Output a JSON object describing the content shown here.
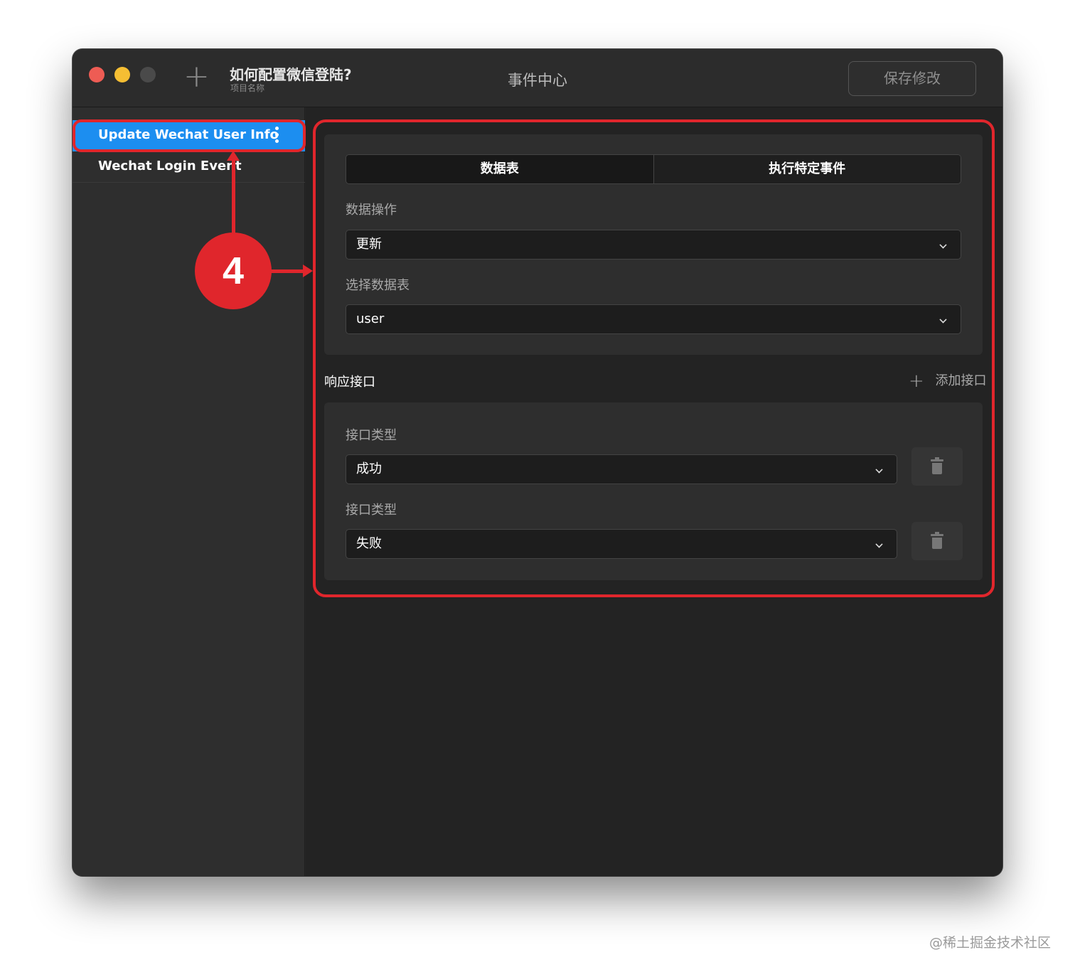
{
  "titlebar": {
    "project_title": "如何配置微信登陆?",
    "project_subtitle": "项目名称",
    "center_title": "事件中心",
    "save_label": "保存修改",
    "add_icon": "+"
  },
  "sidebar": {
    "items": [
      {
        "label": "Update Wechat User Info",
        "active": true
      },
      {
        "label": "Wechat Login Event",
        "active": false
      }
    ]
  },
  "tabs": [
    {
      "label": "数据表",
      "active": true
    },
    {
      "label": "执行特定事件",
      "active": false
    }
  ],
  "data_section": {
    "operation_label": "数据操作",
    "operation_value": "更新",
    "table_label": "选择数据表",
    "table_value": "user"
  },
  "response_section": {
    "title": "响应接口",
    "add_icon": "+",
    "add_label": "添加接口",
    "interfaces": [
      {
        "label": "接口类型",
        "value": "成功"
      },
      {
        "label": "接口类型",
        "value": "失败"
      }
    ]
  },
  "annotation": {
    "step_number": "4",
    "color": "#e0262c"
  },
  "watermark": "@稀土掘金技术社区",
  "colors": {
    "accent": "#1c8ef0",
    "close": "#ee5c54",
    "minimize": "#f5be33",
    "highlight": "#e0262c"
  }
}
